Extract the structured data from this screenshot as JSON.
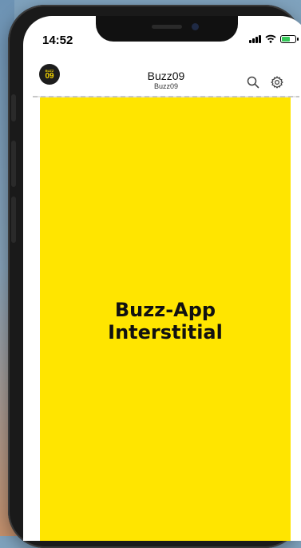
{
  "status_bar": {
    "time": "14:52"
  },
  "header": {
    "logo_line1": "BUZZ",
    "logo_line2": "09",
    "title": "Buzz09",
    "subtitle": "Buzz09",
    "search_icon": "search-icon",
    "settings_icon": "gear-icon"
  },
  "interstitial": {
    "line1": "Buzz-App",
    "line2": "Interstitial",
    "background_color": "#ffe500"
  },
  "colors": {
    "accent": "#ffe500",
    "logo_bg": "#1d1d1d",
    "logo_text": "#f2d200"
  }
}
